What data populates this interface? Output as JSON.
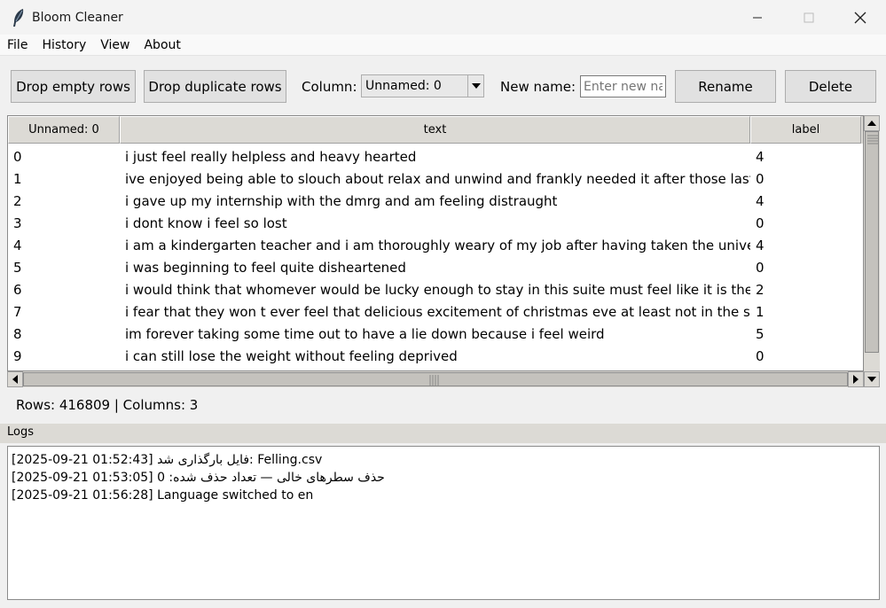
{
  "window": {
    "title": "Bloom Cleaner",
    "icon": "feather-icon",
    "controls": [
      "minimize-icon",
      "maximize-icon",
      "close-icon"
    ]
  },
  "menu": {
    "items": [
      "File",
      "History",
      "View",
      "About"
    ]
  },
  "toolbar": {
    "drop_empty_label": "Drop empty rows",
    "drop_duplicate_label": "Drop duplicate rows",
    "column_label": "Column:",
    "column_value": "Unnamed: 0",
    "new_name_label": "New name:",
    "new_name_placeholder": "Enter new name",
    "rename_label": "Rename",
    "delete_label": "Delete"
  },
  "table": {
    "columns": [
      "Unnamed: 0",
      "text",
      "label"
    ],
    "rows": [
      [
        "0",
        "i just feel really helpless and heavy hearted",
        "4"
      ],
      [
        "1",
        "ive enjoyed being able to slouch about relax and unwind and frankly needed it after those last few",
        "0"
      ],
      [
        "2",
        "i gave up my internship with the dmrg and am feeling distraught",
        "4"
      ],
      [
        "3",
        "i dont know i feel so lost",
        "0"
      ],
      [
        "4",
        "i am a kindergarten teacher and i am thoroughly weary of my job after having taken the university",
        "4"
      ],
      [
        "5",
        "i was beginning to feel quite disheartened",
        "0"
      ],
      [
        "6",
        "i would think that whomever would be lucky enough to stay in this suite must feel like it is the mos",
        "2"
      ],
      [
        "7",
        "i fear that they won t ever feel that delicious excitement of christmas eve at least not in the same w",
        "1"
      ],
      [
        "8",
        "im forever taking some time out to have a lie down because i feel weird",
        "5"
      ],
      [
        "9",
        "i can still lose the weight without feeling deprived",
        "0"
      ]
    ]
  },
  "status": {
    "text": "Rows: 416809 | Columns: 3"
  },
  "logs": {
    "title": "Logs",
    "lines": [
      "[2025-09-21 01:52:43] فایل بارگذاری شد: Felling.csv",
      "[2025-09-21 01:53:05] حذف سطرهای خالی — تعداد حذف شده: 0",
      "[2025-09-21 01:56:28] Language switched to en"
    ]
  },
  "colors": {
    "window_bg": "#f0f0f0",
    "button_bg": "#e1e1e1",
    "header_bg": "#dcdad5"
  }
}
